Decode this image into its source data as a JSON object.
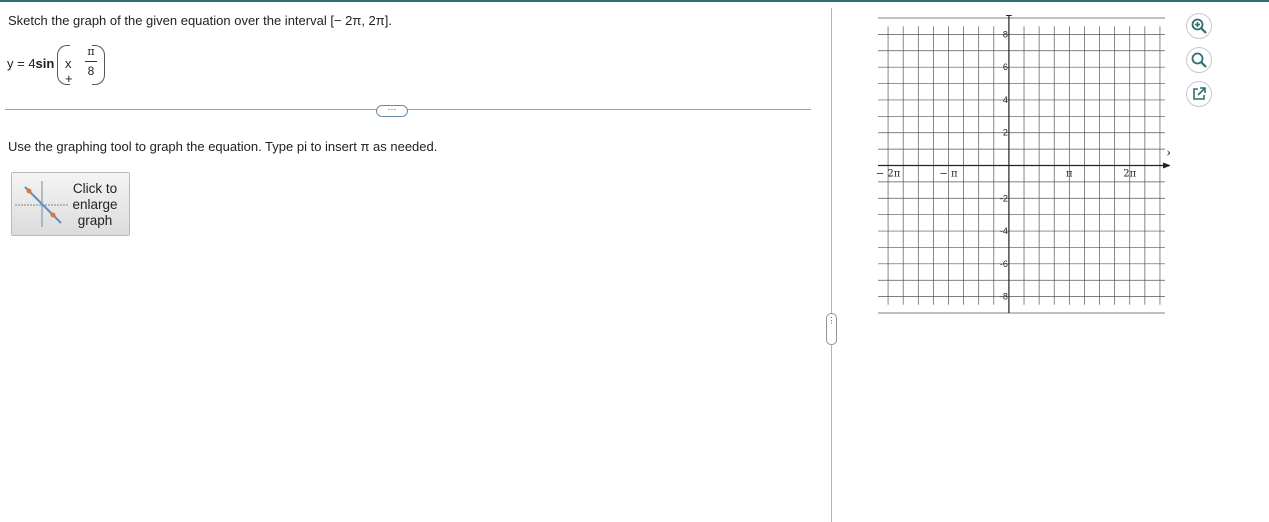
{
  "question": {
    "prompt": "Sketch the graph of the given equation over the interval [− 2π, 2π].",
    "equation": {
      "lhs": "y = 4",
      "func": "sin",
      "var": "x +",
      "numerator": "π",
      "denominator": "8"
    },
    "more_label": "···",
    "instruction": "Use the graphing tool to graph the equation. Type pi to insert π as needed.",
    "enlarge_label": "Click to enlarge graph"
  },
  "graph": {
    "x_axis_label": "x",
    "y_axis_label": "y",
    "x_ticks": [
      {
        "value": -6.2832,
        "label": "− 2π"
      },
      {
        "value": -3.1416,
        "label": "− π"
      },
      {
        "value": 3.1416,
        "label": "π"
      },
      {
        "value": 6.2832,
        "label": "2π"
      }
    ],
    "y_ticks": [
      8,
      6,
      4,
      2,
      -2,
      -4,
      -6,
      -8
    ],
    "x_range": [
      -6.8068,
      8.1158
    ],
    "y_range": [
      -9,
      9
    ],
    "grid_step_x": 0.7854,
    "grid_step_y": 1,
    "grid": true,
    "colors": {
      "grid": "#555555",
      "axes": "#222222",
      "accent": "#2f6f73"
    }
  },
  "tools": {
    "zoom_in": "zoom-in-icon",
    "zoom_out": "zoom-out-icon",
    "popout": "external-link-icon"
  },
  "pane_handle_label": "⋮"
}
